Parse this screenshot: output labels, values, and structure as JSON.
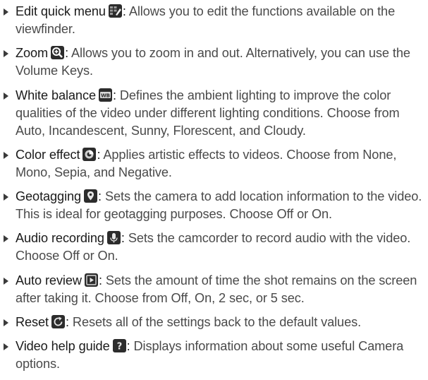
{
  "items": [
    {
      "term": "Edit quick menu",
      "icon": "edit-quick-menu-icon",
      "sep": ": ",
      "desc": "Allows you to edit the functions available on the viewfinder."
    },
    {
      "term": "Zoom",
      "icon": "zoom-icon",
      "sep": ": ",
      "desc": "Allows you to zoom in and out. Alternatively, you can use the Volume Keys."
    },
    {
      "term": "White balance",
      "icon": "white-balance-icon",
      "sep": ": ",
      "desc": "Defines the ambient lighting to improve the color qualities of the video under different lighting conditions. Choose from Auto, Incandescent, Sunny, Florescent, and Cloudy."
    },
    {
      "term": "Color effect",
      "icon": "color-effect-icon",
      "sep": ": ",
      "desc": "Applies artistic effects to videos. Choose from None, Mono, Sepia, and Negative."
    },
    {
      "term": "Geotagging",
      "icon": "geotagging-icon",
      "sep": ": ",
      "desc": "Sets the camera to add location information to the video. This is ideal for geotagging purposes. Choose Off or On."
    },
    {
      "term": "Audio recording",
      "icon": "audio-recording-icon",
      "sep": ": ",
      "desc": "Sets the camcorder to record audio with the video. Choose Off or On."
    },
    {
      "term": "Auto review",
      "icon": "auto-review-icon",
      "sep": ": ",
      "desc": "Sets the amount of time the shot remains on the screen after taking it. Choose from Off, On, 2 sec, or 5 sec."
    },
    {
      "term": "Reset",
      "icon": "reset-icon",
      "sep": ": ",
      "desc": "Resets all of the settings back to the default values."
    },
    {
      "term": "Video help guide",
      "icon": "help-icon",
      "sep": ": ",
      "desc": "Displays information about some useful Camera options."
    }
  ]
}
